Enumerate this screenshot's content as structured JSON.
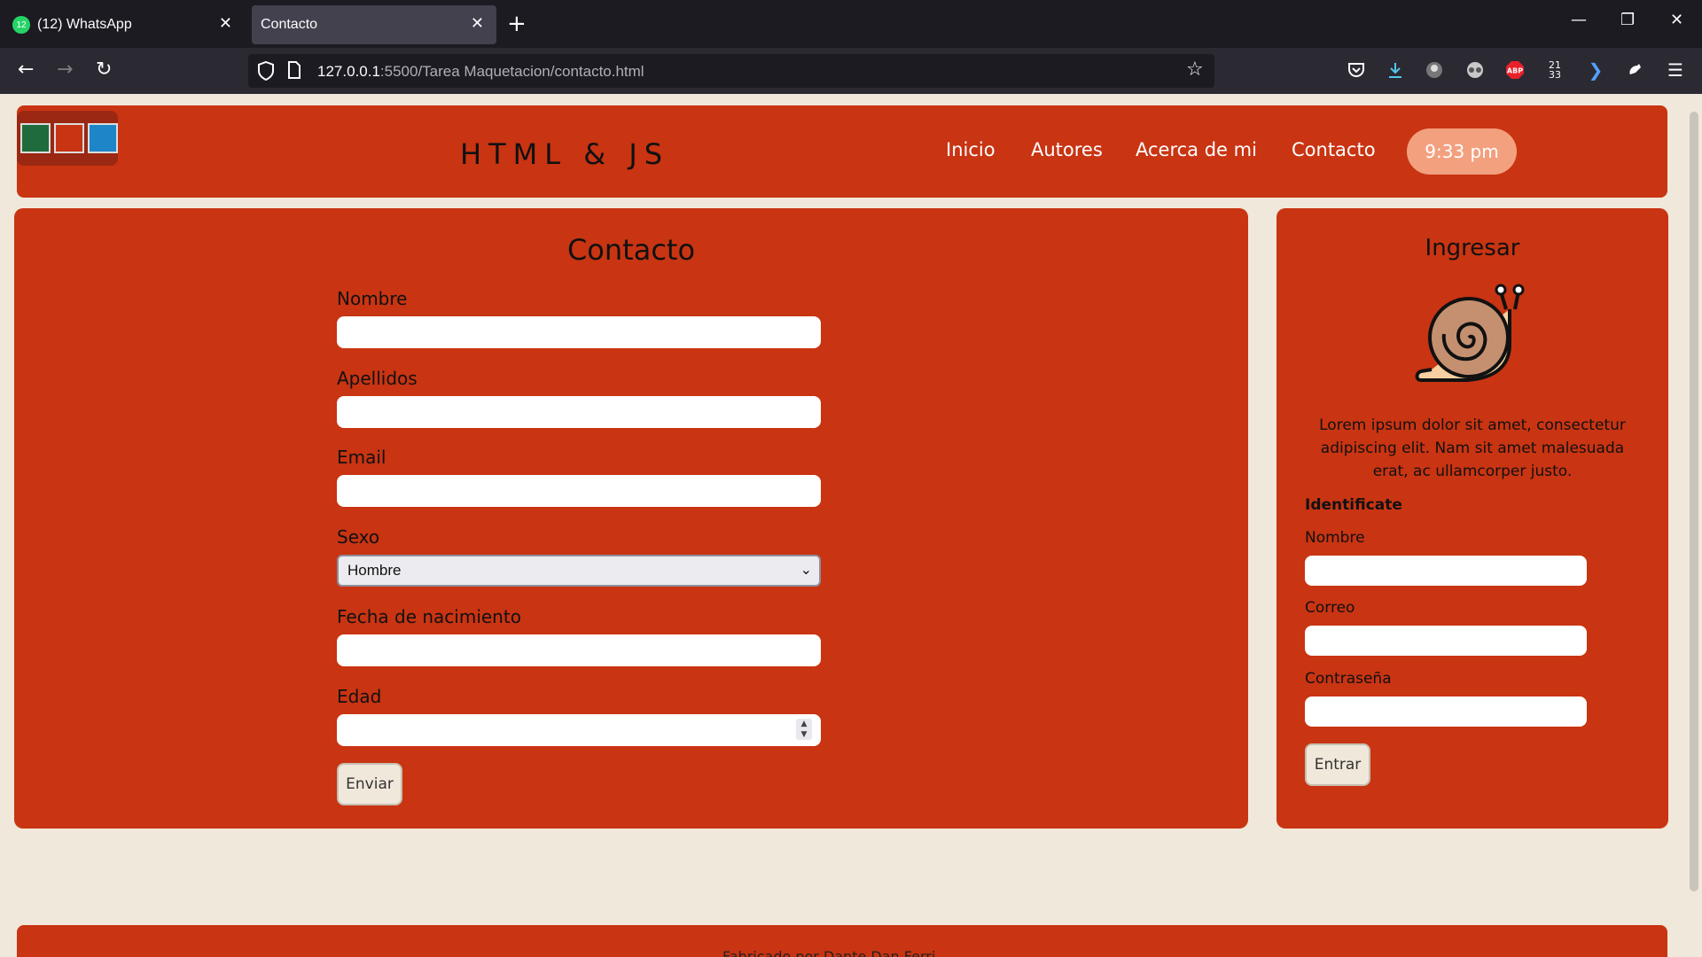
{
  "browser": {
    "tabs": [
      {
        "label": "(12) WhatsApp",
        "badge": "12"
      },
      {
        "label": "Contacto"
      }
    ],
    "url_host": "127.0.0.1",
    "url_rest": ":5500/Tarea Maquetacion/contacto.html",
    "clock_ext": "21\n33"
  },
  "header": {
    "brand": "HTML & JS",
    "nav": [
      "Inicio",
      "Autores",
      "Acerca de mi",
      "Contacto"
    ],
    "time": "9:33 pm",
    "swatch_colors": [
      "#1f6b3d",
      "#c93412",
      "#1e86c8"
    ]
  },
  "contact": {
    "title": "Contacto",
    "fields": {
      "nombre": "Nombre",
      "apellidos": "Apellidos",
      "email": "Email",
      "sexo": "Sexo",
      "fecha": "Fecha de nacimiento",
      "edad": "Edad"
    },
    "sexo_selected": "Hombre",
    "submit": "Enviar"
  },
  "login": {
    "title": "Ingresar",
    "description": "Lorem ipsum dolor sit amet, consectetur adipiscing elit. Nam sit amet malesuada erat, ac ullamcorper justo.",
    "identify": "Identificate",
    "nombre": "Nombre",
    "correo": "Correo",
    "password": "Contraseña",
    "submit": "Entrar"
  },
  "footer": {
    "text": "Fabricado por Dante Dan Ferri..."
  },
  "colors": {
    "accent": "#c93412",
    "background": "#f0e8da",
    "clock_bg": "#f3a07f"
  }
}
